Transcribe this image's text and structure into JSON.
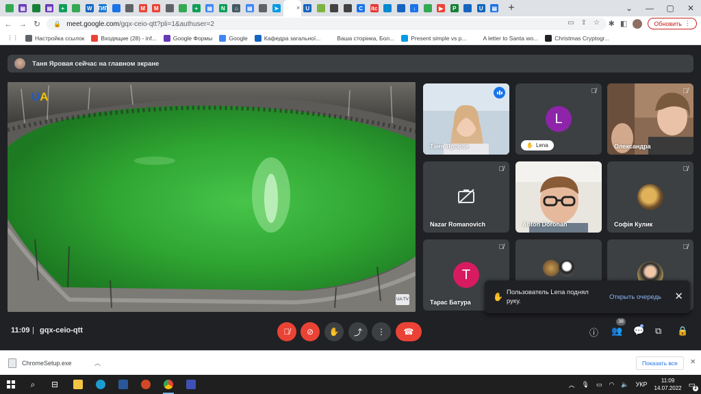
{
  "browser": {
    "tabs": [
      {
        "color": "#34a853",
        "glyph": ""
      },
      {
        "color": "#673ab7",
        "glyph": "▤"
      },
      {
        "color": "#188038",
        "glyph": ""
      },
      {
        "color": "#673ab7",
        "glyph": "▤"
      },
      {
        "color": "#0f9d58",
        "glyph": "+"
      },
      {
        "color": "#34a853",
        "glyph": ""
      },
      {
        "color": "#1565c0",
        "glyph": "W"
      },
      {
        "color": "#1976d2",
        "glyph": "ТИП"
      },
      {
        "color": "#1a73e8",
        "glyph": ""
      },
      {
        "color": "#5f6368",
        "glyph": ""
      },
      {
        "color": "#ea4335",
        "glyph": "M"
      },
      {
        "color": "#ea4335",
        "glyph": "M"
      },
      {
        "color": "#5f6368",
        "glyph": ""
      },
      {
        "color": "#34a853",
        "glyph": ""
      },
      {
        "color": "#0f9d58",
        "glyph": "+"
      },
      {
        "color": "#4285f4",
        "glyph": "▤"
      },
      {
        "color": "#0f9d58",
        "glyph": "N"
      },
      {
        "color": "#455a64",
        "glyph": "⌂"
      },
      {
        "color": "#4285f4",
        "glyph": "▤"
      },
      {
        "color": "#5f6368",
        "glyph": ""
      },
      {
        "color": "#039be5",
        "glyph": "➤"
      },
      {
        "color": "#ffffff",
        "glyph": ""
      },
      {
        "color": "#1565c0",
        "glyph": "U"
      },
      {
        "color": "#7cb342",
        "glyph": ""
      },
      {
        "color": "#424242",
        "glyph": ""
      },
      {
        "color": "#424242",
        "glyph": ""
      },
      {
        "color": "#1a73e8",
        "glyph": "C"
      },
      {
        "color": "#e53935",
        "glyph": "itc"
      },
      {
        "color": "#0288d1",
        "glyph": ""
      },
      {
        "color": "#1565c0",
        "glyph": ""
      },
      {
        "color": "#1a73e8",
        "glyph": "↓"
      },
      {
        "color": "#34a853",
        "glyph": ""
      },
      {
        "color": "#ea4335",
        "glyph": "▶"
      },
      {
        "color": "#188038",
        "glyph": "P"
      },
      {
        "color": "#1565c0",
        "glyph": ""
      },
      {
        "color": "#1565c0",
        "glyph": "U"
      },
      {
        "color": "#1a73e8",
        "glyph": "▤"
      }
    ],
    "new_tab": "+",
    "window_controls": [
      "⌄",
      "—",
      "▢",
      "✕"
    ],
    "url_host": "meet.google.com",
    "url_path": "/gqx-ceio-qtt?pli=1&authuser=2",
    "update_label": "Обновить",
    "bookmarks": [
      {
        "label": "Настройка ссылок",
        "color": "#5f6368"
      },
      {
        "label": "Входящие (28) - inf...",
        "color": "#ea4335"
      },
      {
        "label": "Google Формы",
        "color": "#673ab7"
      },
      {
        "label": "Google",
        "color": "#4285f4"
      },
      {
        "label": "Кафедра загальної...",
        "color": "#1565c0"
      },
      {
        "label": "Ваша сторінка, Бол...",
        "color": "#ffffff"
      },
      {
        "label": "Present simple vs p...",
        "color": "#039be5"
      },
      {
        "label": "A letter to Santa wo...",
        "color": "#ffffff"
      },
      {
        "label": "Christmas Cryptogr...",
        "color": "#202124"
      }
    ]
  },
  "meet": {
    "presenting_banner": "Таня Яровая сейчас на главном экране",
    "main_video": {
      "logo_u": "U",
      "logo_a": "A",
      "badge": "UA:TV"
    },
    "participants": [
      {
        "name": "Таня Яровая",
        "kind": "photo",
        "speaking": true
      },
      {
        "name": "Lena",
        "kind": "letter",
        "letter": "L",
        "color": "#8e24aa",
        "hand_raised": true
      },
      {
        "name": "Олександра",
        "kind": "photo"
      },
      {
        "name": "Nazar Romanovich",
        "kind": "camera-off"
      },
      {
        "name": "Anton Dorohan",
        "kind": "photo"
      },
      {
        "name": "Софія Кулик",
        "kind": "avatar"
      },
      {
        "name": "Тарас Батура",
        "kind": "letter",
        "letter": "T",
        "color": "#d81b60"
      },
      {
        "name": "",
        "kind": "avatars"
      },
      {
        "name": "",
        "kind": "avatar"
      }
    ],
    "toast": {
      "message": "Пользователь Lena поднял руку.",
      "action": "Открыть очередь"
    },
    "bottom": {
      "time": "11:09",
      "separator": "|",
      "meeting_code": "gqx-ceio-qtt",
      "participant_count": "38"
    }
  },
  "downloads": {
    "file": "ChromeSetup.exe",
    "show_all": "Показать все"
  },
  "taskbar": {
    "lang": "УКР",
    "time": "11:09",
    "date": "14.07.2022",
    "notifications": "2"
  }
}
